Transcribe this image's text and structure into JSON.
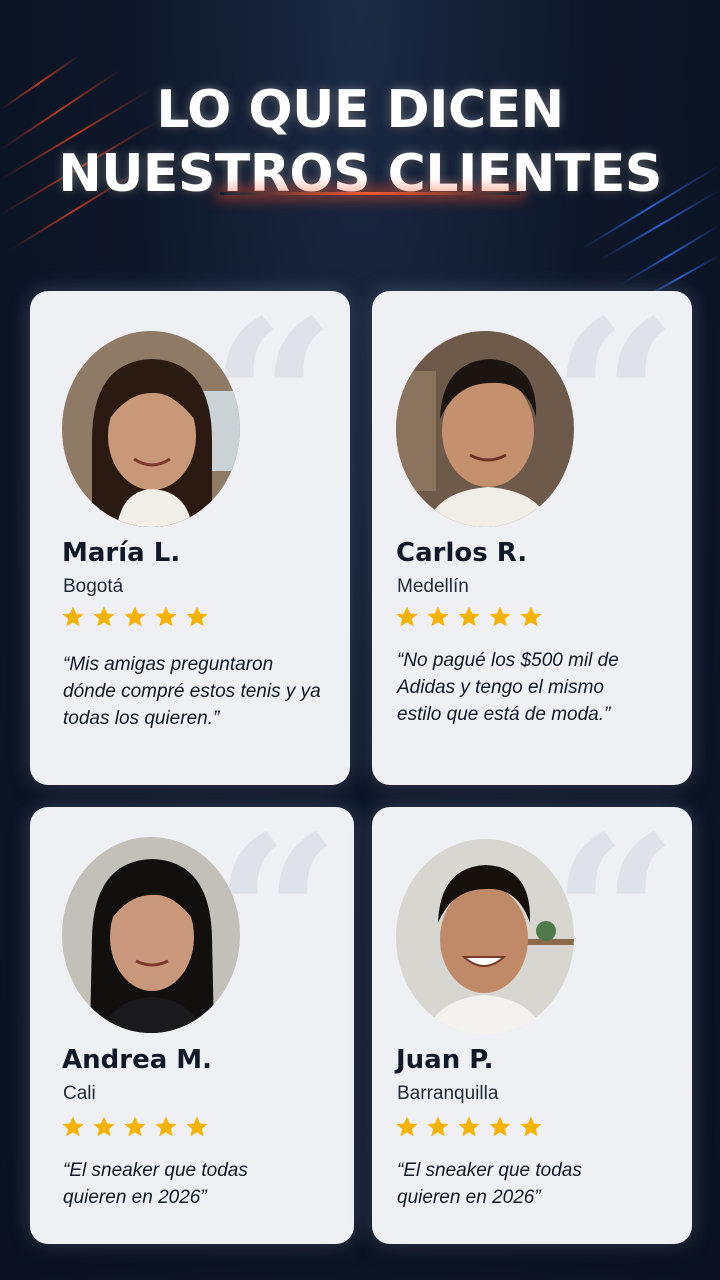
{
  "title": {
    "line1": "LO QUE DICEN",
    "line2": "NUESTROS CLIENTES"
  },
  "colors": {
    "background": "#0e1729",
    "card": "#eef0f4",
    "star": "#f5b301",
    "accent_glow": "#ff5a2a"
  },
  "icons": {
    "quote": "quote-icon",
    "star": "star-icon"
  },
  "reviews": [
    {
      "name": "María L.",
      "city": "Bogotá",
      "rating": 5,
      "quote_glyph": "“",
      "text": "“Mis amigas preguntaron dónde compré estos tenis y ya todas los quieren.”"
    },
    {
      "name": "Carlos R.",
      "city": "Medellín",
      "rating": 5,
      "quote_glyph": "“",
      "text": "“No pagué los $500 mil de Adidas y tengo el mismo estilo que está de moda.”"
    },
    {
      "name": "Andrea M.",
      "city": "Cali",
      "rating": 5,
      "quote_glyph": "“",
      "text": "“El sneaker que todas quieren en 2026”"
    },
    {
      "name": "Juan P.",
      "city": "Barranquilla",
      "rating": 5,
      "quote_glyph": "“",
      "text": "“El sneaker que todas quieren en 2026”"
    }
  ]
}
